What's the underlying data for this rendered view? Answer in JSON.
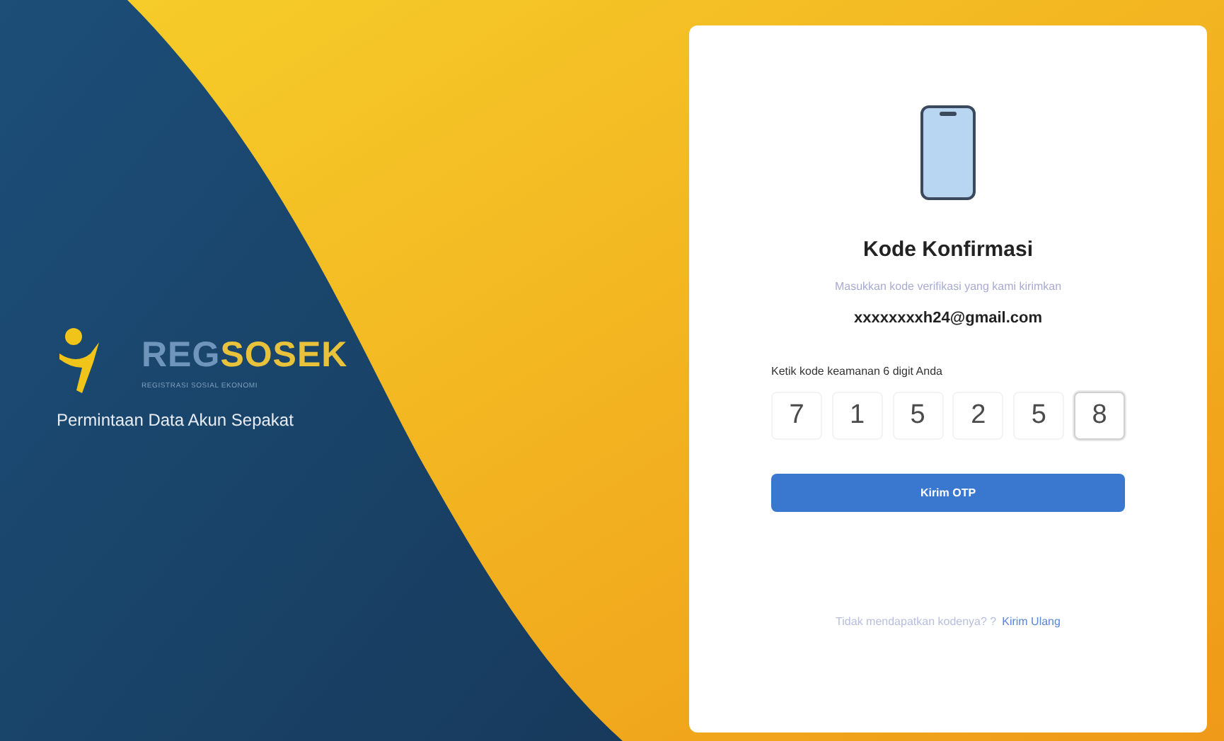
{
  "brand": {
    "logo_prefix": "REG",
    "logo_suffix": "SOSEK",
    "logo_tagline": "REGISTRASI SOSIAL EKONOMI",
    "subtitle": "Permintaan Data Akun Sepakat"
  },
  "card": {
    "title": "Kode Konfirmasi",
    "instruction": "Masukkan kode verifikasi yang kami kirimkan",
    "email": "xxxxxxxxh24@gmail.com",
    "otp_label": "Ketik kode keamanan 6 digit Anda",
    "otp_digits": [
      {
        "value": "7",
        "focused": false
      },
      {
        "value": "1",
        "focused": false
      },
      {
        "value": "5",
        "focused": false
      },
      {
        "value": "2",
        "focused": false
      },
      {
        "value": "5",
        "focused": false
      },
      {
        "value": "8",
        "focused": true
      }
    ],
    "submit_button": "Kirim OTP",
    "resend_prompt": "Tidak mendapatkan kodenya? ?",
    "resend_link": "Kirim Ulang"
  }
}
